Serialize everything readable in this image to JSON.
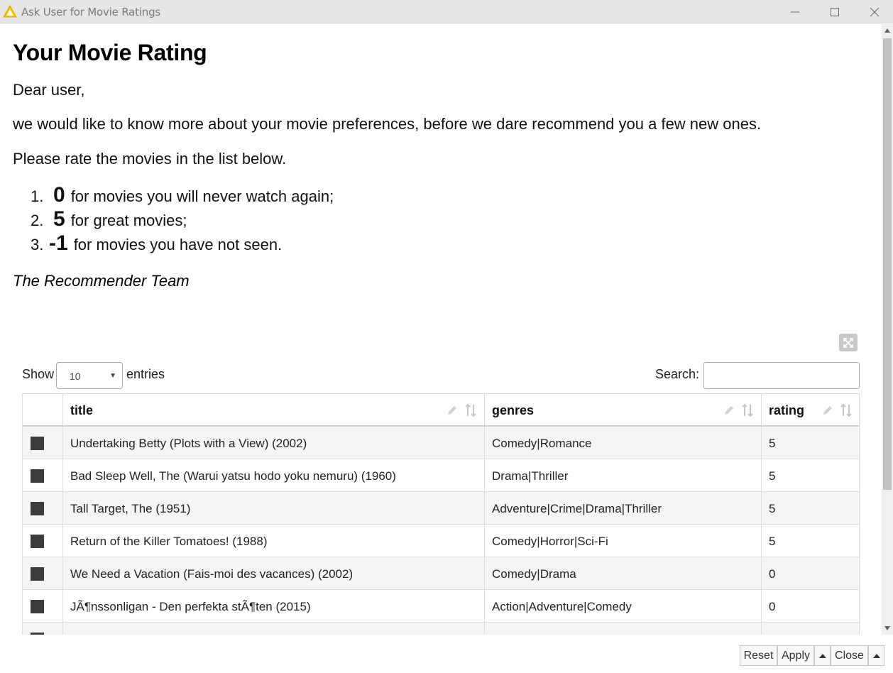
{
  "window": {
    "title": "Ask User for Movie Ratings",
    "icon": "warning-triangle-icon"
  },
  "intro": {
    "heading": "Your Movie Rating",
    "greeting": "Dear user,",
    "line1": "we would like to know more about your movie preferences, before we dare recommend you a few new ones.",
    "line2": "Please rate the movies in the list below.",
    "rules": [
      {
        "num": "1.",
        "value": "0",
        "text": "for movies you will never watch again;"
      },
      {
        "num": "2.",
        "value": "5",
        "text": "for great movies;"
      },
      {
        "num": "3.",
        "value": "-1",
        "text": "for movies you have not seen."
      }
    ],
    "signoff": "The Recommender Team"
  },
  "table_controls": {
    "show_label": "Show",
    "page_size": "10",
    "entries_label": "entries",
    "search_label": "Search:",
    "search_value": ""
  },
  "table": {
    "columns": [
      "title",
      "genres",
      "rating"
    ],
    "rows": [
      {
        "title": "Undertaking Betty (Plots with a View) (2002)",
        "genres": "Comedy|Romance",
        "rating": "5"
      },
      {
        "title": "Bad Sleep Well, The (Warui yatsu hodo yoku nemuru) (1960)",
        "genres": "Drama|Thriller",
        "rating": "5"
      },
      {
        "title": "Tall Target, The (1951)",
        "genres": "Adventure|Crime|Drama|Thriller",
        "rating": "5"
      },
      {
        "title": "Return of the Killer Tomatoes! (1988)",
        "genres": "Comedy|Horror|Sci-Fi",
        "rating": "5"
      },
      {
        "title": "We Need a Vacation (Fais-moi des vacances) (2002)",
        "genres": "Comedy|Drama",
        "rating": "0"
      },
      {
        "title": "JÃ¶nssonligan - Den perfekta stÃ¶ten (2015)",
        "genres": "Action|Adventure|Comedy",
        "rating": "0"
      },
      {
        "title": "",
        "genres": "",
        "rating": ""
      }
    ]
  },
  "buttons": {
    "reset": "Reset",
    "apply": "Apply",
    "close": "Close"
  },
  "colors": {
    "titlebar_bg": "#e6e6e6",
    "warning_icon": "#f5c400",
    "checkbox": "#3c3c3c",
    "row_stripe": "#f5f5f5"
  }
}
